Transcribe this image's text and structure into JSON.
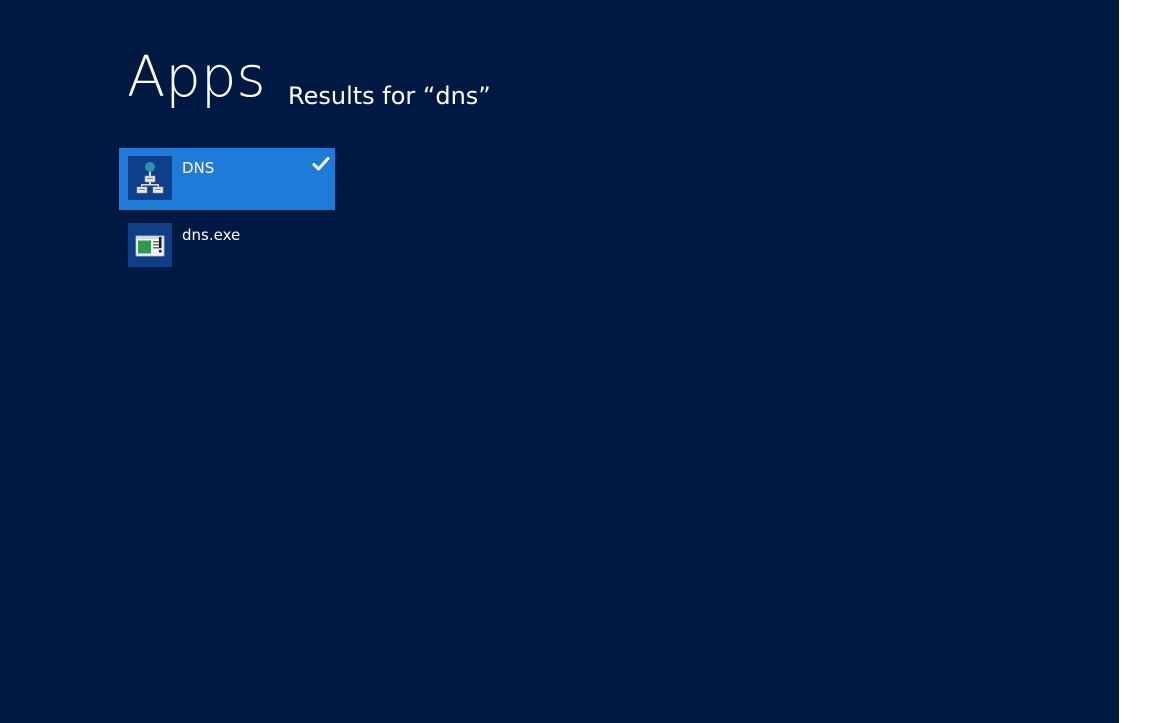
{
  "header": {
    "title": "Apps",
    "results_label": "Results for “dns”"
  },
  "results": [
    {
      "label": "DNS",
      "icon": "dns-manager-icon",
      "selected": true
    },
    {
      "label": "dns.exe",
      "icon": "executable-window-icon",
      "selected": false
    }
  ],
  "colors": {
    "background": "#001942",
    "selection": "#1e7bd8",
    "text": "#ffffff"
  }
}
